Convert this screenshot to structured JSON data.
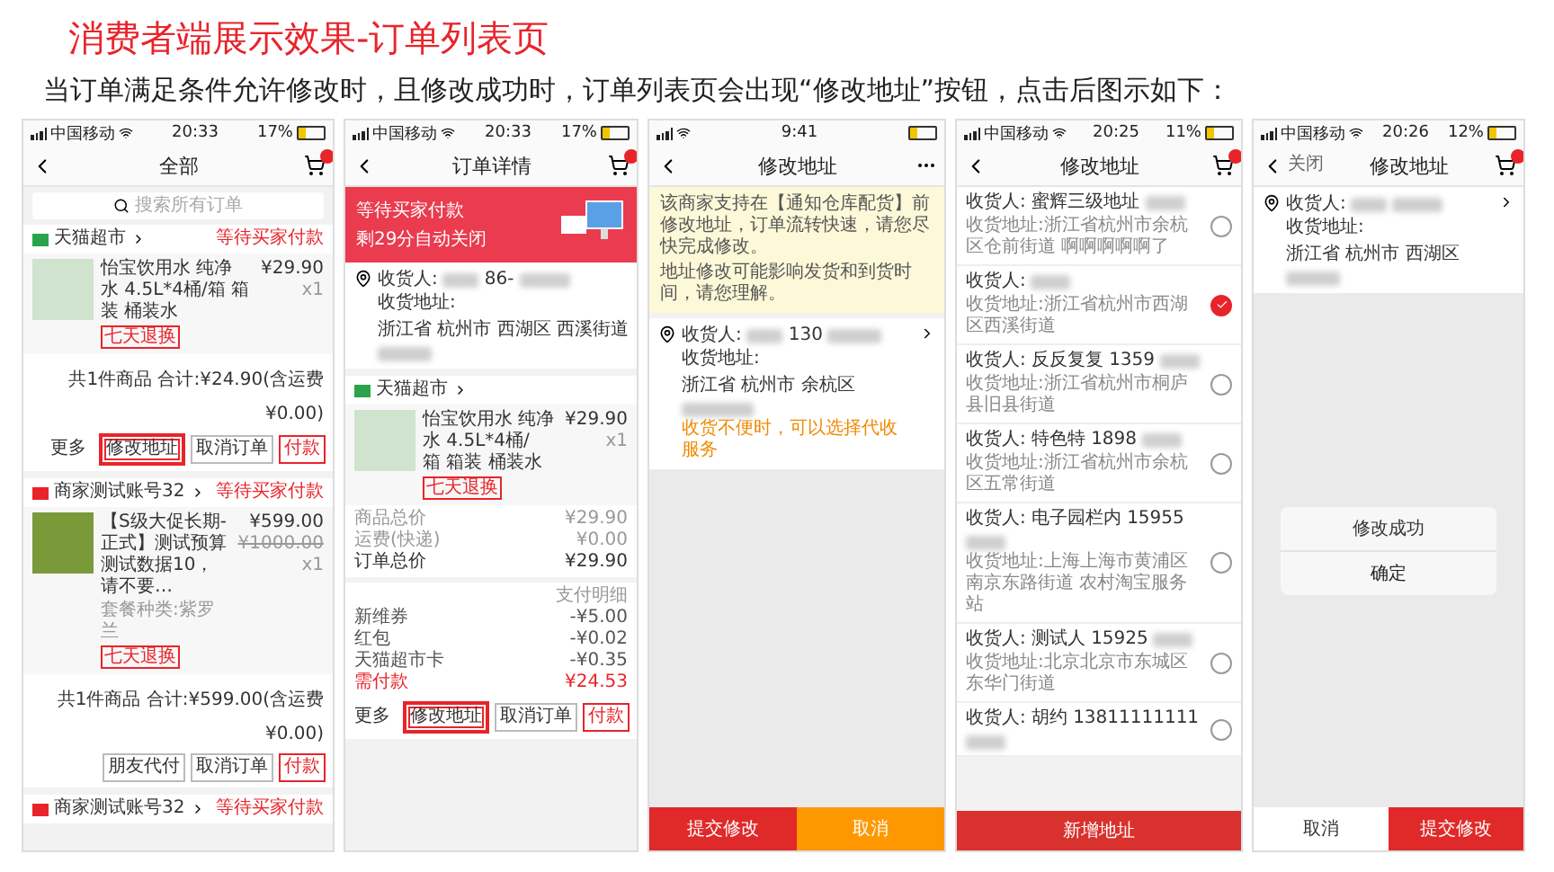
{
  "title": "消费者端展示效果-订单列表页",
  "description": "当订单满足条件允许修改时，且修改成功时，订单列表页会出现“修改地址”按钮，点击后图示如下：",
  "phones": [
    {
      "kind": "order_list",
      "status": {
        "carrier": "中国移动",
        "time": "20:33",
        "battery": "17%"
      },
      "nav": {
        "title": "全部"
      },
      "search_placeholder": "搜索所有订单",
      "orders": [
        {
          "shop": "天猫超市",
          "color": "#2aa34a",
          "status": "等待买家付款",
          "product": "怡宝饮用水 纯净水 4.5L*4桶/箱 箱装 桶装水",
          "tag": "七天退换",
          "price": "¥29.90",
          "qty": "x1",
          "summary": "共1件商品 合计:¥24.90(含运费¥0.00)",
          "buttons": [
            {
              "label": "更多",
              "kind": "link",
              "highlighted": false
            },
            {
              "label": "修改地址",
              "kind": "outline",
              "highlighted": true
            },
            {
              "label": "取消订单",
              "kind": "outline",
              "highlighted": false
            },
            {
              "label": "付款",
              "kind": "primary",
              "highlighted": false
            }
          ]
        },
        {
          "shop": "商家测试账号32",
          "color": "#e8242a",
          "status": "等待买家付款",
          "product": "【S级大促长期-正式】测试预算测试数据10，请不要…",
          "variant": "套餐种类:紫罗兰",
          "tag": "七天退换",
          "price": "¥599.00",
          "old_price": "¥1000.00",
          "qty": "x1",
          "summary": "共1件商品 合计:¥599.00(含运费¥0.00)",
          "buttons": [
            {
              "label": "朋友代付",
              "kind": "outline",
              "highlighted": false
            },
            {
              "label": "取消订单",
              "kind": "outline",
              "highlighted": false
            },
            {
              "label": "付款",
              "kind": "primary",
              "highlighted": false
            }
          ]
        },
        {
          "shop": "商家测试账号32",
          "color": "#e8242a",
          "status": "等待买家付款"
        }
      ]
    },
    {
      "kind": "order_detail",
      "status": {
        "carrier": "中国移动",
        "time": "20:33",
        "battery": "17%"
      },
      "nav": {
        "title": "订单详情"
      },
      "banner": {
        "title": "等待买家付款",
        "subtitle": "剩29分自动关闭"
      },
      "address": {
        "receiver": "收货人:",
        "phone": "86-",
        "label": "收货地址:",
        "address": "浙江省 杭州市 西湖区 西溪街道"
      },
      "shop": "天猫超市",
      "product": "怡宝饮用水 纯净水 4.5L*4桶/箱 箱装 桶装水",
      "tag": "七天退换",
      "price": "¥29.90",
      "qty": "x1",
      "costs": [
        {
          "label": "商品总价",
          "value": "¥29.90",
          "kind": "minor"
        },
        {
          "label": "运费(快递)",
          "value": "¥0.00",
          "kind": "minor"
        },
        {
          "label": "订单总价",
          "value": "¥29.90",
          "kind": "total"
        }
      ],
      "payment_title": "支付明细",
      "payments": [
        {
          "label": "新维券",
          "value": "-¥5.00",
          "kind": "normal"
        },
        {
          "label": "红包",
          "value": "-¥0.02",
          "kind": "normal"
        },
        {
          "label": "天猫超市卡",
          "value": "-¥0.35",
          "kind": "normal"
        },
        {
          "label": "需付款",
          "value": "¥24.53",
          "kind": "due"
        }
      ],
      "buttons": [
        {
          "label": "更多",
          "kind": "link",
          "highlighted": false
        },
        {
          "label": "修改地址",
          "kind": "outline",
          "highlighted": true
        },
        {
          "label": "取消订单",
          "kind": "outline",
          "highlighted": false
        },
        {
          "label": "付款",
          "kind": "primary",
          "highlighted": false
        }
      ]
    },
    {
      "kind": "edit_address",
      "status": {
        "time": "9:41"
      },
      "nav": {
        "title": "修改地址"
      },
      "notice": [
        "该商家支持在【通知仓库配货】前修改地址，订单流转快速，请您尽快完成修改。",
        "地址修改可能影响发货和到货时间，请您理解。"
      ],
      "address": {
        "receiver": "收货人:",
        "phone": "130",
        "label": "收货地址:",
        "address": "浙江省 杭州市 余杭区"
      },
      "hint": "收货不便时，可以选择代收服务",
      "actions": [
        {
          "label": "提交修改",
          "kind": "primary"
        },
        {
          "label": "取消",
          "kind": "secondary"
        }
      ]
    },
    {
      "kind": "address_list",
      "status": {
        "carrier": "中国移动",
        "time": "20:25",
        "battery": "11%"
      },
      "nav": {
        "title": "修改地址"
      },
      "addresses": [
        {
          "name": "收货人: 蜜辉三级地址",
          "address": "收货地址:浙江省杭州市余杭区仓前街道 啊啊啊啊啊了",
          "selected": false
        },
        {
          "name": "收货人:",
          "address": "收货地址:浙江省杭州市西湖区西溪街道",
          "selected": true
        },
        {
          "name": "收货人: 反反复复",
          "phone": "1359",
          "address": "收货地址:浙江省杭州市桐庐县旧县街道",
          "selected": false
        },
        {
          "name": "收货人: 特色特",
          "phone": "1898",
          "address": "收货地址:浙江省杭州市余杭区五常街道",
          "selected": false
        },
        {
          "name": "收货人: 电子园栏内",
          "phone": "15955",
          "address": "收货地址:上海上海市黄浦区南京东路街道 农村淘宝服务站",
          "selected": false
        },
        {
          "name": "收货人: 测试人",
          "phone": "15925",
          "address": "收货地址:北京北京市东城区东华门街道",
          "selected": false
        },
        {
          "name": "收货人: 胡约",
          "phone": "13811111111",
          "selected": false
        }
      ],
      "add_button": "新增地址"
    },
    {
      "kind": "edit_result",
      "status": {
        "carrier": "中国移动",
        "time": "20:26",
        "battery": "12%"
      },
      "nav": {
        "title": "修改地址",
        "back_label": "关闭"
      },
      "address": {
        "receiver": "收货人:",
        "label": "收货地址:",
        "address": "浙江省 杭州市 西湖区"
      },
      "dialog": {
        "message": "修改成功",
        "confirm": "确定"
      },
      "actions": [
        {
          "label": "取消",
          "kind": "plain"
        },
        {
          "label": "提交修改",
          "kind": "primary"
        }
      ]
    }
  ]
}
